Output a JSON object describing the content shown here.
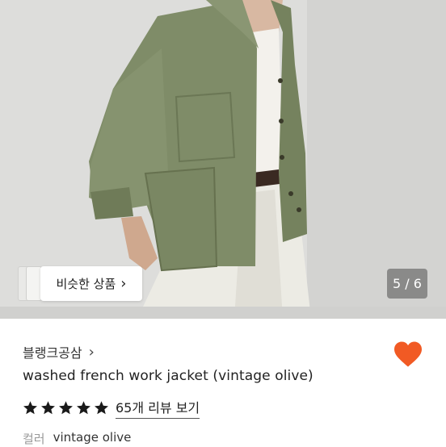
{
  "hero": {
    "similar_button_label": "비슷한 상품",
    "chevron_glyph": "›",
    "image_counter": "5 / 6"
  },
  "product": {
    "shop_name": "블랭크공삼",
    "title": "washed french work jacket (vintage olive)",
    "rating_stars": 5,
    "review_link": "65개 리뷰 보기",
    "color_key": "컬러",
    "color_value": "vintage olive"
  },
  "colors": {
    "heart": "#f15a24",
    "star": "#1a1a1a",
    "jacket": "#7d8a66"
  },
  "icons": {
    "heart": "heart-icon",
    "star": "star-icon",
    "chevron": "chevron-right-icon"
  }
}
